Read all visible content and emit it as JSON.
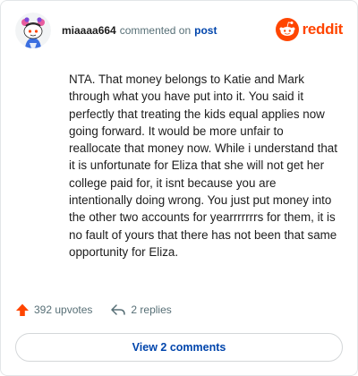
{
  "comment": {
    "username": "miaaaa664",
    "action_text": "commented on",
    "post_link": "post",
    "body": "NTA. That money belongs to Katie and Mark through what you have put into it. You said it perfectly that treating the kids equal applies now going forward. It would be more unfair to reallocate that money now. While i understand that it is unfortunate for Eliza that she will not get her college paid for, it isnt because you are intentionally doing wrong. You just put money into the other two accounts for yearrrrrrrs for them, it is no fault of yours that there has not been that same opportunity for Eliza."
  },
  "brand": {
    "name": "reddit",
    "color": "#ff4500"
  },
  "actions": {
    "upvotes": "392 upvotes",
    "replies": "2 replies",
    "view_comments": "View 2 comments"
  },
  "icons": {
    "avatar": "snoo-avatar-icon",
    "logo": "reddit-logo-icon",
    "upvote": "upvote-arrow-icon",
    "reply": "reply-arrow-icon"
  }
}
